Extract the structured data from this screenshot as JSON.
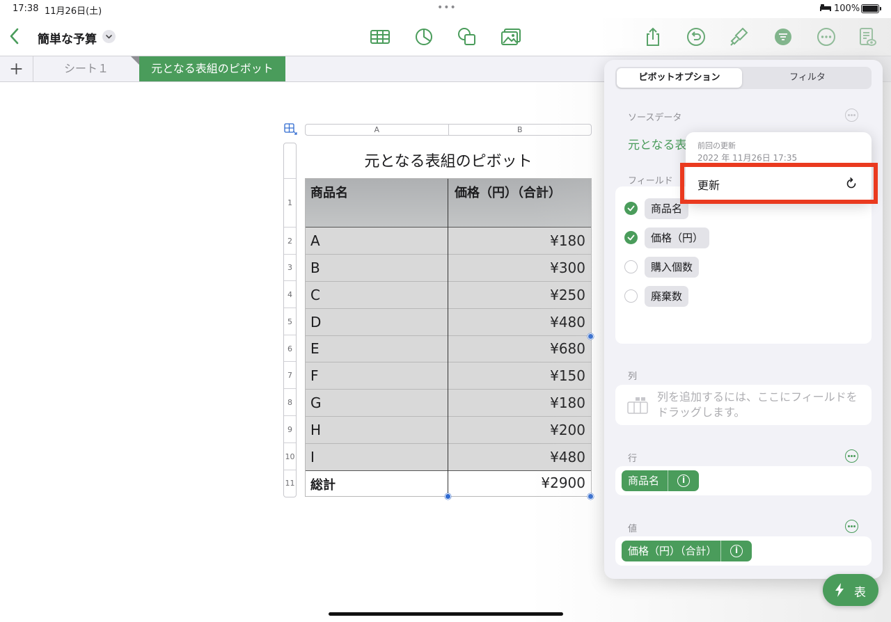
{
  "status_bar": {
    "time": "17:38",
    "date": "11月26日(土)",
    "battery": "100%"
  },
  "toolbar": {
    "document_title": "簡単な予算",
    "icons": [
      "table-icon",
      "chart-icon",
      "shape-icon",
      "media-icon",
      "share-icon",
      "undo-icon",
      "format-brush-icon",
      "organize-icon",
      "more-icon",
      "reader-view-icon"
    ],
    "accent_color": "#4a9c5b"
  },
  "sheet_tabs": {
    "items": [
      "シート１",
      "元となる表組のピボット"
    ],
    "active_index": 1
  },
  "sheet": {
    "column_headers": [
      "A",
      "B"
    ],
    "row_numbers": [
      "1",
      "2",
      "3",
      "4",
      "5",
      "6",
      "7",
      "8",
      "9",
      "10",
      "11"
    ],
    "table_title": "元となる表組のピボット",
    "header": [
      "商品名",
      "価格（円）（合計）"
    ],
    "rows": [
      {
        "name": "A",
        "price": "¥180"
      },
      {
        "name": "B",
        "price": "¥300"
      },
      {
        "name": "C",
        "price": "¥250"
      },
      {
        "name": "D",
        "price": "¥480"
      },
      {
        "name": "E",
        "price": "¥680"
      },
      {
        "name": "F",
        "price": "¥150"
      },
      {
        "name": "G",
        "price": "¥180"
      },
      {
        "name": "H",
        "price": "¥200"
      },
      {
        "name": "I",
        "price": "¥480"
      }
    ],
    "total_row": {
      "name": "総計",
      "price": "¥2900"
    }
  },
  "pivot_panel": {
    "tabs": [
      "ピボットオプション",
      "フィルタ"
    ],
    "active_tab": 0,
    "source_data_label": "ソースデータ",
    "source_data_value": "元となる表",
    "fields_label": "フィールド",
    "fields": [
      {
        "name": "商品名",
        "checked": true
      },
      {
        "name": "価格（円）",
        "checked": true
      },
      {
        "name": "購入個数",
        "checked": false
      },
      {
        "name": "廃棄数",
        "checked": false
      }
    ],
    "columns_label": "列",
    "columns_placeholder": "列を追加するには、ここにフィールドをドラッグします。",
    "rows_label": "行",
    "rows_fields": [
      "商品名"
    ],
    "values_label": "値",
    "values_fields": [
      "価格（円）（合計）"
    ]
  },
  "refresh_popover": {
    "last_updated_label": "前回の更新",
    "last_updated_value": "2022 年 11月26日 17:35",
    "refresh_label": "更新",
    "highlight_color": "#ea3a1f"
  },
  "quick_button": {
    "label": "表"
  }
}
